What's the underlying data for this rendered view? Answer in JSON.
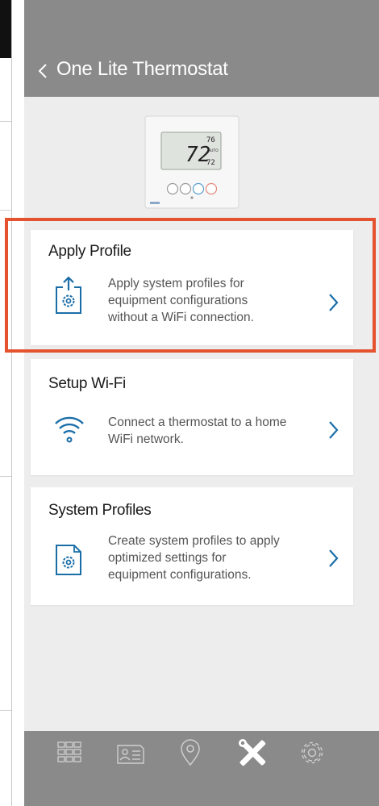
{
  "header": {
    "back_icon": "chevron-left-icon",
    "title": "One Lite Thermostat"
  },
  "device": {
    "image": "thermostat-device",
    "display_temp": "72",
    "display_set_high": "76",
    "display_set_low": "72",
    "display_mode": "AUTO"
  },
  "cards": [
    {
      "title": "Apply Profile",
      "icon": "apply-profile-icon",
      "description": [
        "Apply system profiles for",
        "equipment configurations",
        "without a WiFi connection."
      ],
      "highlighted": true
    },
    {
      "title": "Setup Wi-Fi",
      "icon": "wifi-icon",
      "description": [
        "Connect a thermostat to a home",
        "WiFi network."
      ]
    },
    {
      "title": "System Profiles",
      "icon": "system-profile-icon",
      "description": [
        "Create system profiles to apply",
        "optimized settings for",
        "equipment configurations."
      ]
    }
  ],
  "tabbar": {
    "tabs": [
      "grid-icon",
      "contact-card-icon",
      "location-pin-icon",
      "tools-icon",
      "settings-gear-icon"
    ],
    "active": "tools-icon"
  },
  "colors": {
    "header_bg": "#8a8a8a",
    "page_bg": "#ededed",
    "accent_blue": "#1a6ea8",
    "highlight": "#e5522f"
  }
}
